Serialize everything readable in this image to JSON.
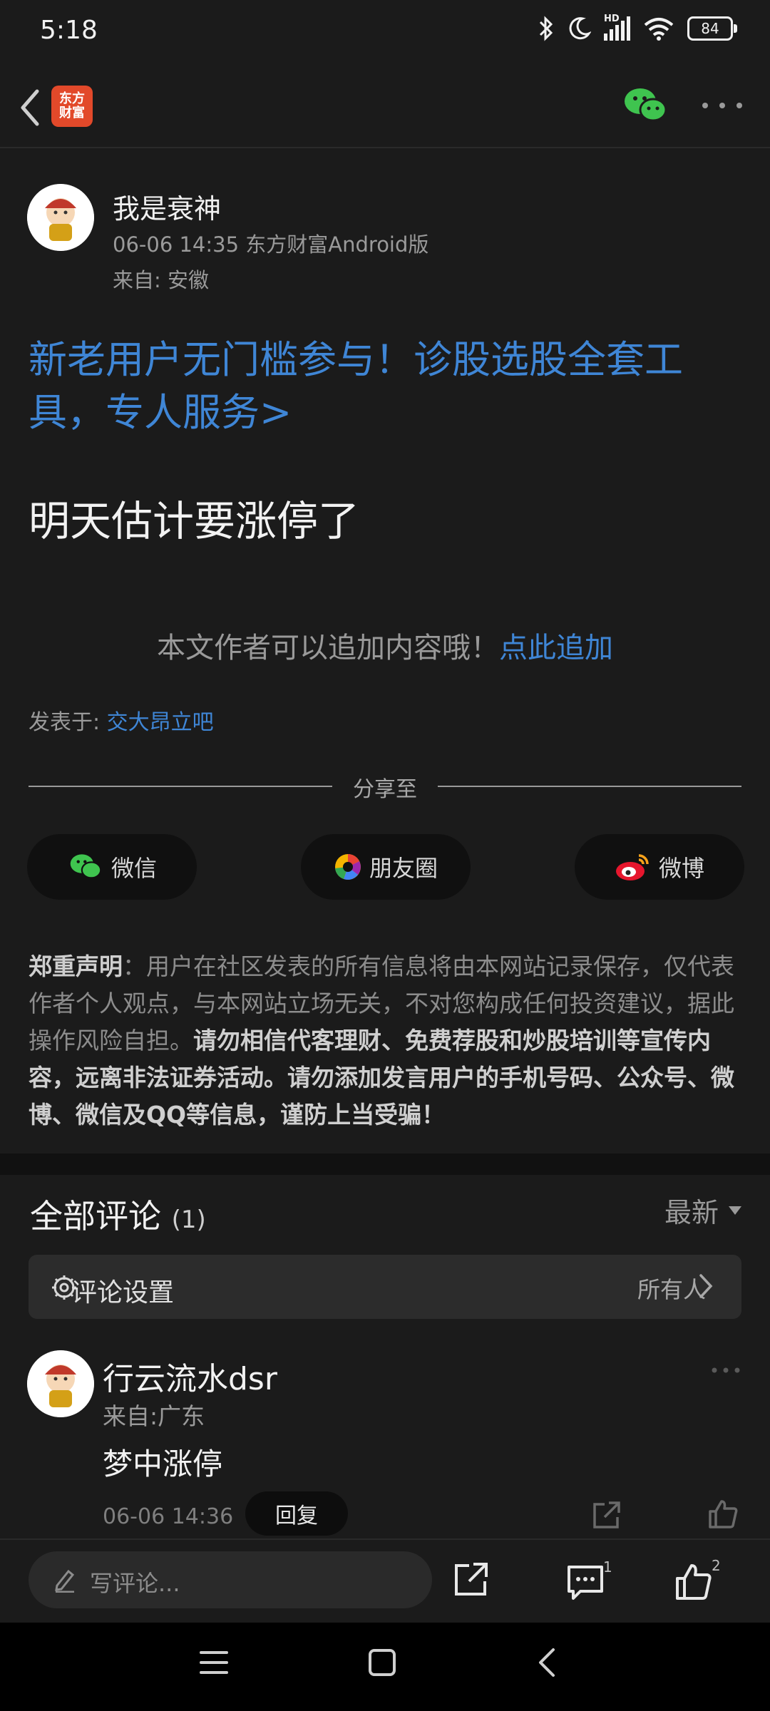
{
  "status": {
    "time": "5:18",
    "battery": "84",
    "hd_label": "HD"
  },
  "nav": {
    "logo_text": "东方\n财富"
  },
  "post": {
    "author": "我是衰神",
    "meta_line": "06-06 14:35 东方财富Android版",
    "from_line": "来自: 安徽",
    "promo": "新老用户无门槛参与！诊股选股全套工具，专人服务>",
    "content": "明天估计要涨停了",
    "append_text": "本文作者可以追加内容哦！",
    "append_link": "点此追加",
    "posted_label": "发表于: ",
    "posted_link": "交大昂立吧"
  },
  "share": {
    "title": "分享至",
    "buttons": [
      {
        "label": "微信"
      },
      {
        "label": "朋友圈"
      },
      {
        "label": "微博"
      }
    ]
  },
  "disclaimer": {
    "label": "郑重声明",
    "text1": "：用户在社区发表的所有信息将由本网站记录保存，仅代表作者个人观点，与本网站立场无关，不对您构成任何投资建议，据此操作风险自担。",
    "text2": "请勿相信代客理财、免费荐股和炒股培训等宣传内容，远离非法证券活动。请勿添加发言用户的手机号码、公众号、微博、微信及QQ等信息，谨防上当受骗！"
  },
  "comments": {
    "title": "全部评论",
    "count": "(1)",
    "sort": "最新",
    "settings_label": "评论设置",
    "settings_value": "所有人",
    "items": [
      {
        "name": "行云流水dsr",
        "from": "来自:广东",
        "text": "梦中涨停",
        "time": "06-06 14:36",
        "reply_label": "回复"
      }
    ]
  },
  "bottom": {
    "write_placeholder": "写评论...",
    "comment_count": "1",
    "like_count": "2"
  },
  "colors": {
    "accent": "#3f86d6",
    "background": "#1b1b1b",
    "brand": "#e2492a"
  }
}
